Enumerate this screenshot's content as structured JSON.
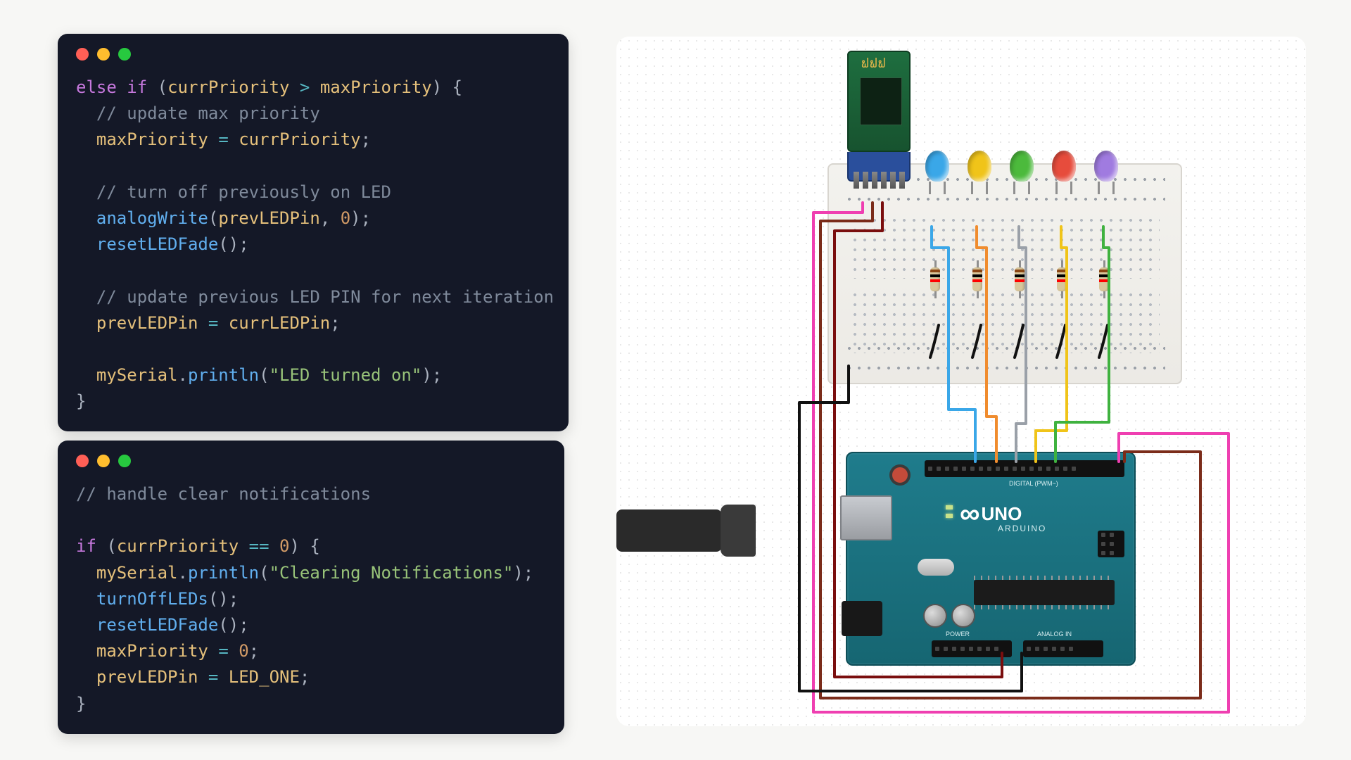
{
  "windows": [
    {
      "id": "code1",
      "controls": [
        "close",
        "minimize",
        "zoom"
      ]
    },
    {
      "id": "code2",
      "controls": [
        "close",
        "minimize",
        "zoom"
      ]
    }
  ],
  "code_block_1": {
    "l1_kw1": "else",
    "l1_kw2": "if",
    "l1_open": "(",
    "l1_var1": "currPriority",
    "l1_op": ">",
    "l1_var2": "maxPriority",
    "l1_close": ") {",
    "l2_cmt": "// update max priority",
    "l3_var1": "maxPriority",
    "l3_op": "=",
    "l3_var2": "currPriority",
    "l3_semi": ";",
    "l5_cmt": "// turn off previously on LED",
    "l6_fn": "analogWrite",
    "l6_open": "(",
    "l6_arg1": "prevLEDPin",
    "l6_comma": ",",
    "l6_num": "0",
    "l6_close": ");",
    "l7_fn": "resetLEDFade",
    "l7_par": "();",
    "l9_cmt": "// update previous LED PIN for next iteration",
    "l10_var1": "prevLEDPin",
    "l10_op": "=",
    "l10_var2": "currLEDPin",
    "l10_semi": ";",
    "l12_obj": "mySerial",
    "l12_dot": ".",
    "l12_fn": "println",
    "l12_open": "(",
    "l12_str": "\"LED turned on\"",
    "l12_close": ");",
    "l13_brace": "}"
  },
  "code_block_2": {
    "l1_cmt": "// handle clear notifications",
    "l3_kw": "if",
    "l3_open": "(",
    "l3_var": "currPriority",
    "l3_eq": "==",
    "l3_num": "0",
    "l3_close": ") {",
    "l4_obj": "mySerial",
    "l4_dot": ".",
    "l4_fn": "println",
    "l4_open": "(",
    "l4_str": "\"Clearing Notifications\"",
    "l4_close": ");",
    "l5_fn": "turnOffLEDs",
    "l5_par": "();",
    "l6_fn": "resetLEDFade",
    "l6_par": "();",
    "l7_var": "maxPriority",
    "l7_op": "=",
    "l7_num": "0",
    "l7_semi": ";",
    "l8_var1": "prevLEDPin",
    "l8_op": "=",
    "l8_var2": "LED_ONE",
    "l8_semi": ";",
    "l9_brace": "}"
  },
  "diagram": {
    "leds": [
      {
        "name": "led-blue",
        "color": "#3aa7e8"
      },
      {
        "name": "led-yellow",
        "color": "#f0c419"
      },
      {
        "name": "led-green",
        "color": "#4cba3c"
      },
      {
        "name": "led-red",
        "color": "#e74c3c"
      },
      {
        "name": "led-purple",
        "color": "#a07be0"
      }
    ],
    "arduino": {
      "model": "UNO",
      "brand": "ARDUINO",
      "pin_group_top_left": "DIGITAL (PWM~)",
      "pin_group_bottom_left": "POWER",
      "pin_group_bottom_right": "ANALOG IN"
    },
    "components": {
      "bt_module": "HC-05 Bluetooth",
      "resistor_count": 5,
      "usb_cable": "USB-B"
    }
  }
}
